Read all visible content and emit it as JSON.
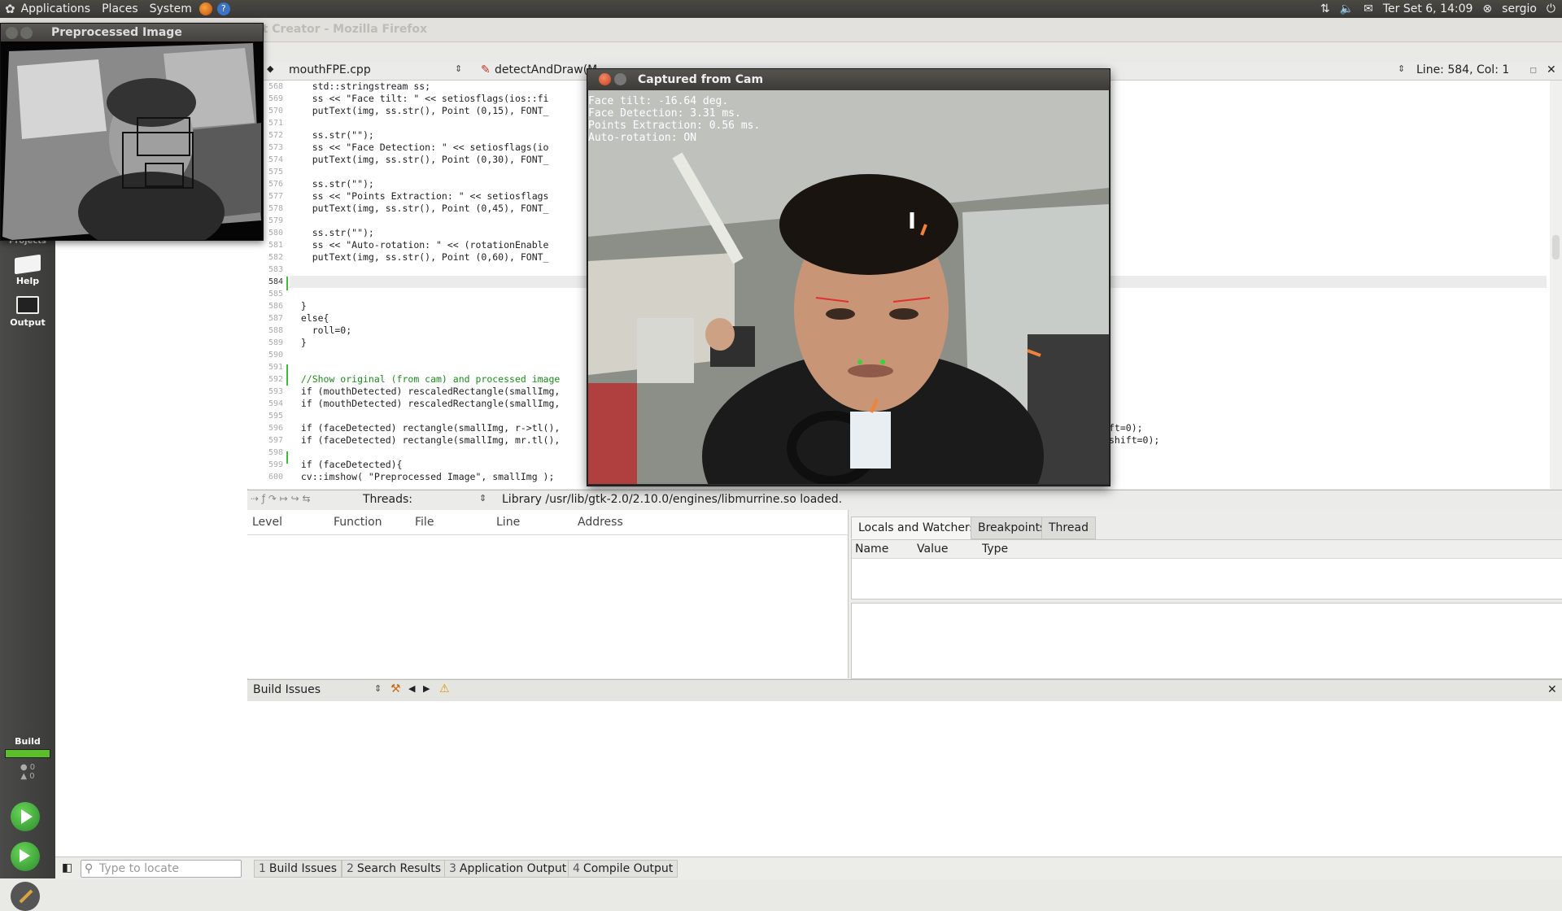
{
  "top_panel": {
    "menus": [
      "Applications",
      "Places",
      "System"
    ],
    "clock": "Ter Set  6, 14:09",
    "user": "sergio"
  },
  "qt_window": {
    "title": "mouthFPE - Qt Creator",
    "faded_title": "mouthFPE - Qt Creator - Mozilla Firefox"
  },
  "modes": {
    "projects": "Projects",
    "help": "Help",
    "output": "Output",
    "build": "Build",
    "errors_count": "0",
    "warnings_count": "0"
  },
  "editor_toolbar": {
    "file": "mouthFPE.cpp",
    "symbol": "detectAndDraw(M",
    "position": "Line: 584, Col: 1"
  },
  "code": [
    {
      "ln": "568",
      "text": "    std::stringstream ss;"
    },
    {
      "ln": "569",
      "text": "    ss << \"Face tilt: \" << setiosflags(ios::fi"
    },
    {
      "ln": "570",
      "text": "    putText(img, ss.str(), Point (0,15), FONT_"
    },
    {
      "ln": "571",
      "text": ""
    },
    {
      "ln": "572",
      "text": "    ss.str(\"\");"
    },
    {
      "ln": "573",
      "text": "    ss << \"Face Detection: \" << setiosflags(io"
    },
    {
      "ln": "574",
      "text": "    putText(img, ss.str(), Point (0,30), FONT_"
    },
    {
      "ln": "575",
      "text": ""
    },
    {
      "ln": "576",
      "text": "    ss.str(\"\");"
    },
    {
      "ln": "577",
      "text": "    ss << \"Points Extraction: \" << setiosflags"
    },
    {
      "ln": "578",
      "text": "    putText(img, ss.str(), Point (0,45), FONT_"
    },
    {
      "ln": "579",
      "text": ""
    },
    {
      "ln": "580",
      "text": "    ss.str(\"\");"
    },
    {
      "ln": "581",
      "text": "    ss << \"Auto-rotation: \" << (rotationEnable"
    },
    {
      "ln": "582",
      "text": "    putText(img, ss.str(), Point (0,60), FONT_"
    },
    {
      "ln": "583",
      "text": ""
    },
    {
      "ln": "584",
      "text": ""
    },
    {
      "ln": "585",
      "text": ""
    },
    {
      "ln": "586",
      "text": "  }"
    },
    {
      "ln": "587",
      "text": "  else{"
    },
    {
      "ln": "588",
      "text": "    roll=0;"
    },
    {
      "ln": "589",
      "text": "  }"
    },
    {
      "ln": "590",
      "text": ""
    },
    {
      "ln": "591",
      "text": ""
    },
    {
      "ln": "592",
      "text": "  //Show original (from cam) and processed image"
    },
    {
      "ln": "593",
      "text": "  if (mouthDetected) rescaledRectangle(smallImg,"
    },
    {
      "ln": "594",
      "text": "  if (mouthDetected) rescaledRectangle(smallImg,"
    },
    {
      "ln": "595",
      "text": ""
    },
    {
      "ln": "596",
      "text": "  if (faceDetected) rectangle(smallImg, r->tl(),"
    },
    {
      "ln": "597",
      "text": "  if (faceDetected) rectangle(smallImg, mr.tl(),"
    },
    {
      "ln": "598",
      "text": ""
    },
    {
      "ln": "599",
      "text": "  if (faceDetected){"
    },
    {
      "ln": "600",
      "text": "  cv::imshow( \"Preprocessed Image\", smallImg );"
    }
  ],
  "code_right_fragments": [
    "ft=0);",
    "shift=0);"
  ],
  "debug_toolbar": {
    "threads_label": "Threads:",
    "message": "Library /usr/lib/gtk-2.0/2.10.0/engines/libmurrine.so loaded."
  },
  "stack_columns": [
    "Level",
    "Function",
    "File",
    "Line",
    "Address"
  ],
  "locals_tabs": [
    "Locals and Watchers",
    "Breakpoints",
    "Thread"
  ],
  "locals_columns": [
    "Name",
    "Value",
    "Type"
  ],
  "build_issues": {
    "title": "Build Issues"
  },
  "statusbar": {
    "locate_placeholder": "Type to locate",
    "panes": [
      {
        "num": "1",
        "label": "Build Issues"
      },
      {
        "num": "2",
        "label": "Search Results"
      },
      {
        "num": "3",
        "label": "Application Output"
      },
      {
        "num": "4",
        "label": "Compile Output"
      }
    ]
  },
  "preprocessed_window": {
    "title": "Preprocessed Image"
  },
  "cam_window": {
    "title": "Captured from Cam",
    "overlay": [
      "Face tilt: -16.64 deg.",
      "Face Detection: 3.31 ms.",
      "Points Extraction: 0.56 ms.",
      "Auto-rotation: ON"
    ]
  },
  "colors": {
    "panel": "#3e3c38",
    "build_progress": "#5cbf2a",
    "run_green": "#3cb33a"
  }
}
